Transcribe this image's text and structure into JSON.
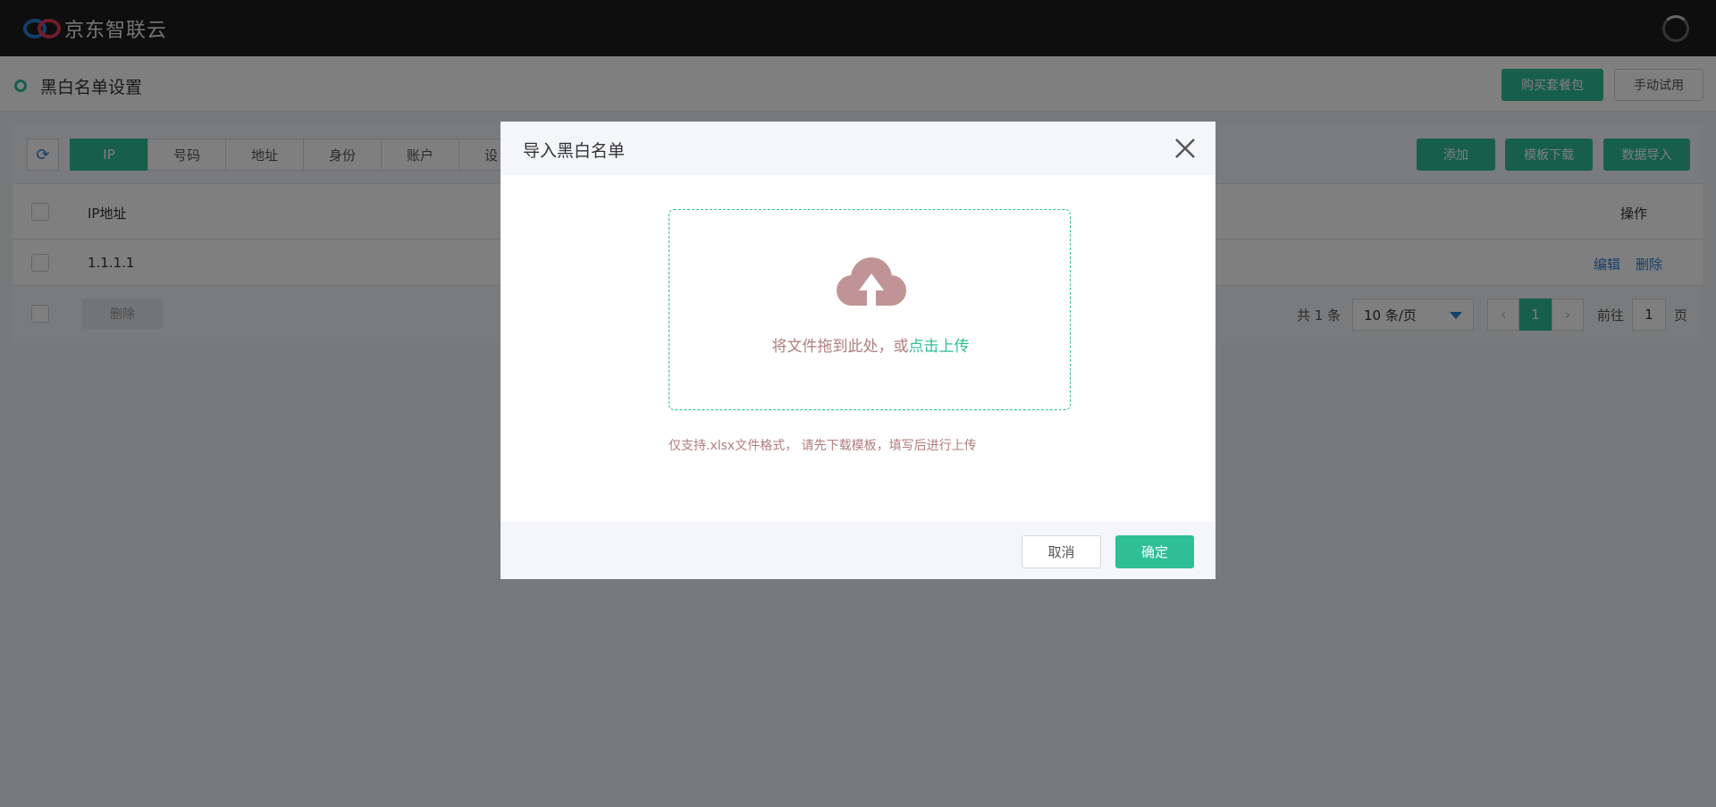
{
  "app": {
    "brand": "京东智联云"
  },
  "header": {
    "title": "黑白名单设置",
    "buy_label": "购买套餐包",
    "trial_label": "手动试用"
  },
  "tabs": [
    {
      "label": "IP"
    },
    {
      "label": "号码"
    },
    {
      "label": "地址"
    },
    {
      "label": "身份"
    },
    {
      "label": "账户"
    },
    {
      "label": "设"
    }
  ],
  "toolbar": {
    "add_label": "添加",
    "template_label": "模板下载",
    "import_label": "数据导入"
  },
  "table": {
    "columns": [
      "IP地址",
      "操作"
    ],
    "rows": [
      {
        "ip": "1.1.1.1",
        "edit": "编辑",
        "delete": "删除"
      }
    ],
    "bulk_delete_label": "删除"
  },
  "pagination": {
    "total_text": "共 1 条",
    "page_size": "10 条/页",
    "current_page": "1",
    "goto_label": "前往",
    "goto_value": "1",
    "page_suffix": "页"
  },
  "modal": {
    "title": "导入黑白名单",
    "drop_text": "将文件拖到此处，或",
    "drop_link": "点击上传",
    "hint": "仅支持.xlsx文件格式，  请先下载模板，填写后进行上传",
    "cancel_label": "取消",
    "ok_label": "确定"
  }
}
